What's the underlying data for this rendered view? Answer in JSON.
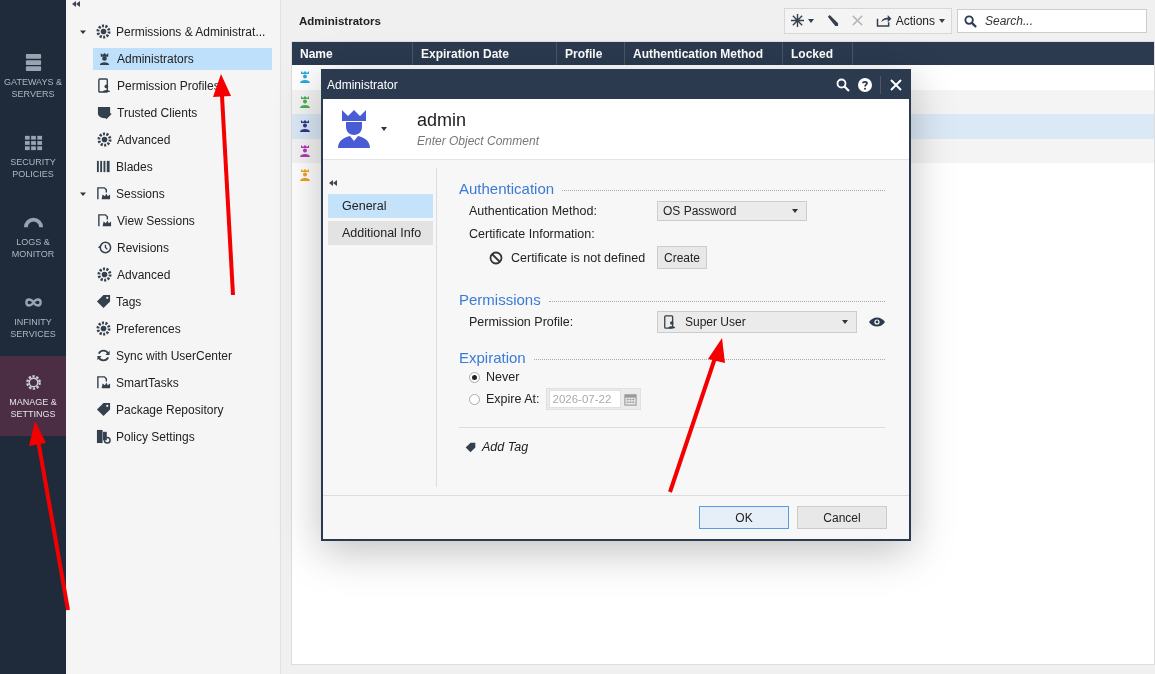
{
  "rail": [
    {
      "label": "GATEWAYS & SERVERS",
      "selected": false
    },
    {
      "label": "SECURITY POLICIES",
      "selected": false
    },
    {
      "label": "LOGS & MONITOR",
      "selected": false
    },
    {
      "label": "INFINITY SERVICES",
      "selected": false
    },
    {
      "label": "MANAGE & SETTINGS",
      "selected": true
    }
  ],
  "tree": [
    {
      "label": "Permissions & Administrat...",
      "expanded": true,
      "selected": false,
      "children": [
        {
          "label": "Administrators",
          "selected": true
        },
        {
          "label": "Permission Profiles",
          "selected": false
        },
        {
          "label": "Trusted Clients",
          "selected": false
        },
        {
          "label": "Advanced",
          "selected": false
        }
      ]
    },
    {
      "label": "Blades",
      "selected": false
    },
    {
      "label": "Sessions",
      "expanded": true,
      "selected": false,
      "children": [
        {
          "label": "View Sessions",
          "selected": false
        },
        {
          "label": "Revisions",
          "selected": false
        },
        {
          "label": "Advanced",
          "selected": false
        }
      ]
    },
    {
      "label": "Tags",
      "selected": false
    },
    {
      "label": "Preferences",
      "selected": false
    },
    {
      "label": "Sync with UserCenter",
      "selected": false
    },
    {
      "label": "SmartTasks",
      "selected": false
    },
    {
      "label": "Package Repository",
      "selected": false
    },
    {
      "label": "Policy Settings",
      "selected": false
    }
  ],
  "main": {
    "title": "Administrators",
    "actions_label": "Actions",
    "search": {
      "placeholder": "Search..."
    }
  },
  "table": {
    "columns": [
      "Name",
      "Expiration Date",
      "Profile",
      "Authentication Method",
      "Locked"
    ],
    "rows": [
      {
        "color": "#29a9e0",
        "selected": false
      },
      {
        "color": "#4caf50",
        "selected": false
      },
      {
        "color": "#2b3a8f",
        "selected": true
      },
      {
        "color": "#b03ab8",
        "selected": false
      },
      {
        "color": "#f0a020",
        "selected": false
      }
    ]
  },
  "dialog": {
    "title": "Administrator",
    "name": "admin",
    "comment": {
      "placeholder": "Enter Object Comment"
    },
    "tabs": [
      {
        "label": "General",
        "selected": true
      },
      {
        "label": "Additional Info",
        "selected": false
      }
    ],
    "authentication": {
      "heading": "Authentication",
      "method_label": "Authentication Method:",
      "method_value": "OS Password",
      "cert_label": "Certificate Information:",
      "cert_status": "Certificate is not defined",
      "create_button": "Create"
    },
    "permissions": {
      "heading": "Permissions",
      "profile_label": "Permission Profile:",
      "profile_value": "Super User"
    },
    "expiration": {
      "heading": "Expiration",
      "options": [
        {
          "label": "Never",
          "selected": true
        },
        {
          "label": "Expire At:",
          "selected": false
        }
      ],
      "date": {
        "value": "2026-07-22",
        "disabled": true
      }
    },
    "add_tag": "Add Tag",
    "buttons": [
      {
        "label": "OK",
        "default": true
      },
      {
        "label": "Cancel",
        "default": false
      }
    ]
  }
}
